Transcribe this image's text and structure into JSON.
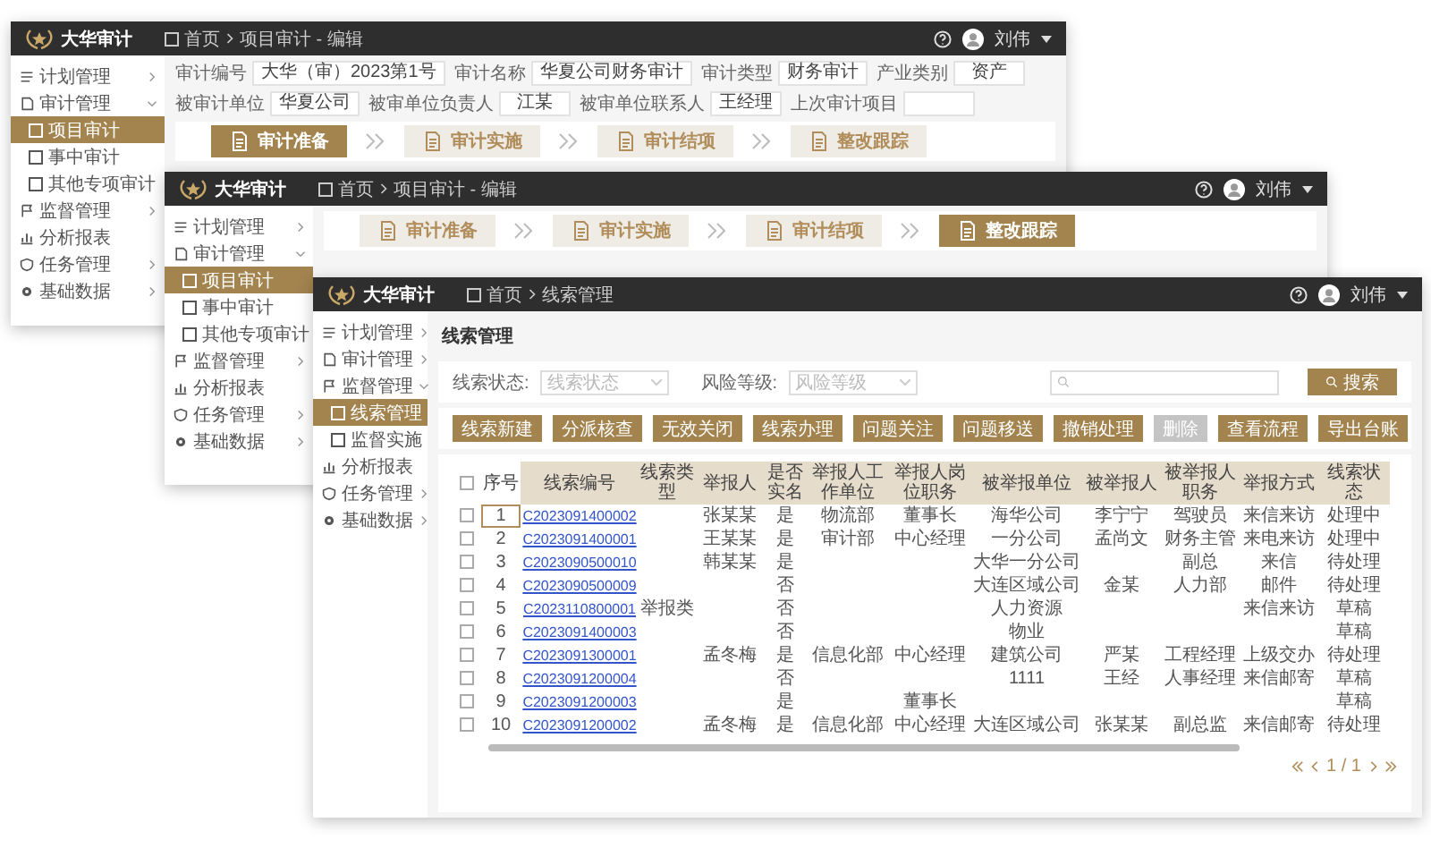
{
  "windows": [
    {
      "kind": "project_edit",
      "app_name": "大华审计",
      "breadcrumb": [
        "首页",
        "项目审计 - 编辑"
      ],
      "user": "刘伟",
      "sidebar": [
        {
          "label": "计划管理",
          "expanded": false,
          "selected": false
        },
        {
          "label": "审计管理",
          "expanded": true,
          "selected": false,
          "children": [
            {
              "label": "项目审计",
              "selected": true
            },
            {
              "label": "事中审计",
              "selected": false
            },
            {
              "label": "其他专项审计",
              "selected": false
            }
          ]
        },
        {
          "label": "监督管理",
          "expanded": false,
          "selected": false
        },
        {
          "label": "分析报表",
          "selected": false
        },
        {
          "label": "任务管理",
          "expanded": false,
          "selected": false
        },
        {
          "label": "基础数据",
          "expanded": false,
          "selected": false
        }
      ],
      "form": [
        [
          {
            "label": "审计编号",
            "value": "大华（审）2023第1号"
          },
          {
            "label": "审计名称",
            "value": "华夏公司财务审计"
          },
          {
            "label": "审计类型",
            "value": "财务审计"
          },
          {
            "label": "产业类别",
            "value": "资产"
          }
        ],
        [
          {
            "label": "被审计单位",
            "value": "华夏公司"
          },
          {
            "label": "被审单位负责人",
            "value": "江某"
          },
          {
            "label": "被审单位联系人",
            "value": "王经理"
          },
          {
            "label": "上次审计项目"
          }
        ]
      ],
      "steps": [
        {
          "label": "审计准备",
          "selected": true
        },
        {
          "label": "审计实施",
          "selected": false
        },
        {
          "label": "审计结项",
          "selected": false
        },
        {
          "label": "整改跟踪",
          "selected": false
        }
      ]
    },
    {
      "kind": "project_steps",
      "app_name": "大华审计",
      "breadcrumb": [
        "首页",
        "项目审计 - 编辑"
      ],
      "user": "刘伟",
      "sidebar": [
        {
          "label": "计划管理",
          "expanded": false,
          "selected": false
        },
        {
          "label": "审计管理",
          "expanded": true,
          "selected": false,
          "children": [
            {
              "label": "项目审计",
              "selected": true
            },
            {
              "label": "事中审计",
              "selected": false
            },
            {
              "label": "其他专项审计",
              "selected": false
            }
          ]
        },
        {
          "label": "监督管理",
          "expanded": false,
          "selected": false
        },
        {
          "label": "分析报表",
          "selected": false
        },
        {
          "label": "任务管理",
          "expanded": false,
          "selected": false
        },
        {
          "label": "基础数据",
          "expanded": false,
          "selected": false
        }
      ],
      "steps": [
        {
          "label": "审计准备",
          "selected": false
        },
        {
          "label": "审计实施",
          "selected": false
        },
        {
          "label": "审计结项",
          "selected": false
        },
        {
          "label": "整改跟踪",
          "selected": true
        }
      ]
    },
    {
      "kind": "clue_list",
      "app_name": "大华审计",
      "breadcrumb": [
        "首页",
        "线索管理"
      ],
      "user": "刘伟",
      "sidebar": [
        {
          "label": "计划管理",
          "expanded": false,
          "selected": false
        },
        {
          "label": "审计管理",
          "expanded": false,
          "selected": false
        },
        {
          "label": "监督管理",
          "expanded": true,
          "selected": false,
          "children": [
            {
              "label": "线索管理",
              "selected": true
            },
            {
              "label": "监督实施",
              "selected": false
            }
          ]
        },
        {
          "label": "分析报表",
          "selected": false
        },
        {
          "label": "任务管理",
          "expanded": false,
          "selected": false
        },
        {
          "label": "基础数据",
          "expanded": false,
          "selected": false
        }
      ],
      "title": "线索管理",
      "filters": [
        {
          "label": "线索状态:",
          "placeholder": "线索状态"
        },
        {
          "label": "风险等级:",
          "placeholder": "风险等级"
        }
      ],
      "search_button": "搜索",
      "actions": [
        {
          "label": "线索新建",
          "disabled": false
        },
        {
          "label": "分派核查",
          "disabled": false
        },
        {
          "label": "无效关闭",
          "disabled": false
        },
        {
          "label": "线索办理",
          "disabled": false
        },
        {
          "label": "问题关注",
          "disabled": false
        },
        {
          "label": "问题移送",
          "disabled": false
        },
        {
          "label": "撤销处理",
          "disabled": false
        },
        {
          "label": "删除",
          "disabled": true
        },
        {
          "label": "查看流程",
          "disabled": false
        },
        {
          "label": "导出台账",
          "disabled": false
        }
      ],
      "table": {
        "all_checked": false,
        "columns": [
          {
            "label": "序号",
            "kind": "text"
          },
          {
            "label": "线索编号",
            "kind": "link"
          },
          {
            "label": "线索类型",
            "kind": "text"
          },
          {
            "label": "举报人",
            "kind": "text"
          },
          {
            "label": "是否实名",
            "kind": "text"
          },
          {
            "label": "举报人工作单位",
            "kind": "text"
          },
          {
            "label": "举报人岗位职务",
            "kind": "text"
          },
          {
            "label": "被举报单位",
            "kind": "text"
          },
          {
            "label": "被举报人",
            "kind": "text"
          },
          {
            "label": "被举报人职务",
            "kind": "text"
          },
          {
            "label": "举报方式",
            "kind": "text"
          },
          {
            "label": "线索状态",
            "kind": "text"
          }
        ],
        "rows": [
          {
            "checked": false,
            "focused": true,
            "cells": [
              "1",
              "C2023091400002",
              "",
              "张某某",
              "是",
              "物流部",
              "董事长",
              "海华公司",
              "李宁宁",
              "驾驶员",
              "来信来访",
              "处理中"
            ]
          },
          {
            "checked": false,
            "focused": false,
            "cells": [
              "2",
              "C2023091400001",
              "",
              "王某某",
              "是",
              "审计部",
              "中心经理",
              "一分公司",
              "孟尚文",
              "财务主管",
              "来电来访",
              "处理中"
            ]
          },
          {
            "checked": false,
            "focused": false,
            "cells": [
              "3",
              "C2023090500010",
              "",
              "韩某某",
              "是",
              "",
              "",
              "大华一分公司",
              "",
              "副总",
              "来信",
              "待处理"
            ]
          },
          {
            "checked": false,
            "focused": false,
            "cells": [
              "4",
              "C2023090500009",
              "",
              "",
              "否",
              "",
              "",
              "大连区域公司",
              "金某",
              "人力部",
              "邮件",
              "待处理"
            ]
          },
          {
            "checked": false,
            "focused": false,
            "cells": [
              "5",
              "C2023110800001",
              "举报类",
              "",
              "否",
              "",
              "",
              "人力资源",
              "",
              "",
              "来信来访",
              "草稿"
            ]
          },
          {
            "checked": false,
            "focused": false,
            "cells": [
              "6",
              "C2023091400003",
              "",
              "",
              "否",
              "",
              "",
              "物业",
              "",
              "",
              "",
              "草稿"
            ]
          },
          {
            "checked": false,
            "focused": false,
            "cells": [
              "7",
              "C2023091300001",
              "",
              "孟冬梅",
              "是",
              "信息化部",
              "中心经理",
              "建筑公司",
              "严某",
              "工程经理",
              "上级交办",
              "待处理"
            ]
          },
          {
            "checked": false,
            "focused": false,
            "cells": [
              "8",
              "C2023091200004",
              "",
              "",
              "否",
              "",
              "",
              "1111",
              "王经",
              "人事经理",
              "来信邮寄",
              "草稿"
            ]
          },
          {
            "checked": false,
            "focused": false,
            "cells": [
              "9",
              "C2023091200003",
              "",
              "",
              "是",
              "",
              "董事长",
              "",
              "",
              "",
              "",
              "草稿"
            ]
          },
          {
            "checked": false,
            "focused": false,
            "cells": [
              "10",
              "C2023091200002",
              "",
              "孟冬梅",
              "是",
              "信息化部",
              "中心经理",
              "大连区域公司",
              "张某某",
              "副总监",
              "来信邮寄",
              "待处理"
            ]
          }
        ]
      },
      "pagination": "1 / 1"
    }
  ]
}
